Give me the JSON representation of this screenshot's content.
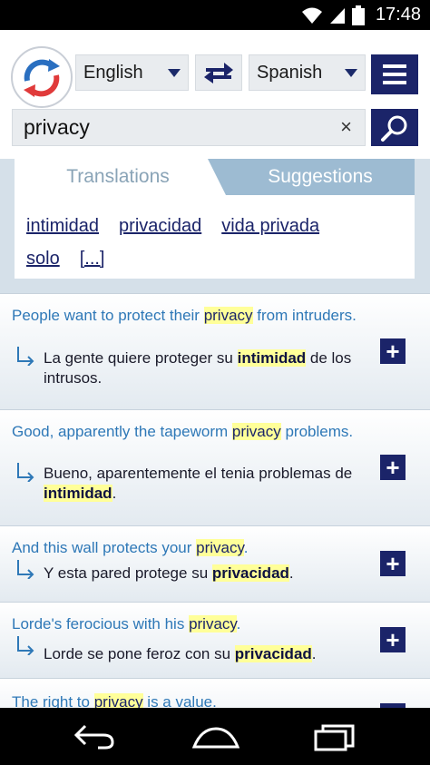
{
  "status_bar": {
    "time": "17:48",
    "icons": [
      "wifi-icon",
      "signal-icon",
      "battery-icon"
    ]
  },
  "header": {
    "source_language": "English",
    "target_language": "Spanish",
    "icons": [
      "app-logo",
      "swap-icon",
      "menu-icon",
      "search-icon",
      "clear-icon"
    ]
  },
  "search": {
    "query": "privacy",
    "clear_label": "×"
  },
  "tabs": {
    "translations": "Translations",
    "suggestions": "Suggestions"
  },
  "translations": [
    "intimidad",
    "privacidad",
    "vida privada",
    "solo",
    "[...]"
  ],
  "examples": [
    {
      "en_before": "People want to protect their ",
      "en_hl": "privacy",
      "en_after": " from intruders.",
      "es_before": "La gente quiere proteger su ",
      "es_hl": "intimidad",
      "es_after": " de los intrusos."
    },
    {
      "en_before": "Good, apparently the tapeworm ",
      "en_hl": "privacy",
      "en_after": " problems.",
      "es_before": "Bueno, aparentemente el tenia problemas de ",
      "es_hl": "intimidad",
      "es_after": "."
    },
    {
      "en_before": "And this wall protects your ",
      "en_hl": "privacy",
      "en_after": ".",
      "es_before": "Y esta pared protege su ",
      "es_hl": "privacidad",
      "es_after": "."
    },
    {
      "en_before": "Lorde's ferocious with his ",
      "en_hl": "privacy",
      "en_after": ".",
      "es_before": "Lorde se pone feroz con su ",
      "es_hl": "privacidad",
      "es_after": "."
    },
    {
      "en_before": "The right to ",
      "en_hl": "privacy",
      "en_after": " is a value."
    }
  ],
  "add_label": "+",
  "nav_bar": {
    "icons": [
      "back-icon",
      "home-icon",
      "recents-icon"
    ]
  },
  "colors": {
    "brand_navy": "#1b2469",
    "example_blue": "#2e78b7",
    "highlight": "#ffff99",
    "tab_active": "#9dbbd2"
  }
}
